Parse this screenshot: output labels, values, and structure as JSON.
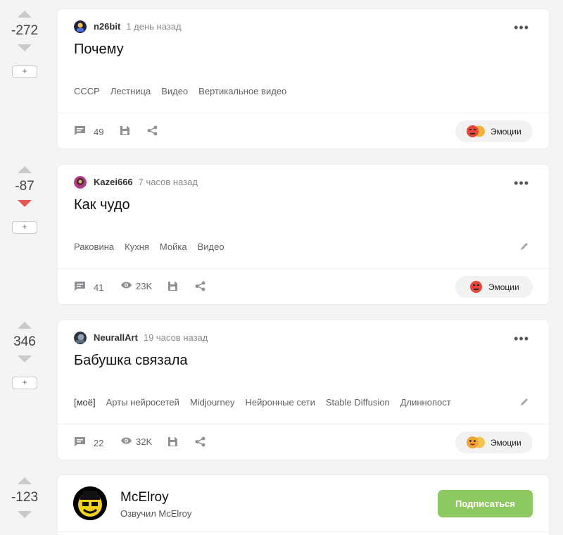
{
  "posts": [
    {
      "rating": "-272",
      "author": "n26bit",
      "time": "1 день назад",
      "title": "Почему",
      "tags": [
        "СССР",
        "Лестница",
        "Видео",
        "Вертикальное видео"
      ],
      "comments": "49",
      "views": "",
      "emotions_label": "Эмоции"
    },
    {
      "rating": "-87",
      "author": "Kazei666",
      "time": "7 часов назад",
      "title": "Как чудо",
      "tags": [
        "Раковина",
        "Кухня",
        "Мойка",
        "Видео"
      ],
      "comments": "41",
      "views": "23K",
      "emotions_label": "Эмоции"
    },
    {
      "rating": "346",
      "author": "NeurallArt",
      "time": "19 часов назад",
      "title": "Бабушка связала",
      "tags": [
        "[моё]",
        "Арты нейросетей",
        "Midjourney",
        "Нейронные сети",
        "Stable Diffusion",
        "Длиннопост"
      ],
      "comments": "22",
      "views": "32K",
      "emotions_label": "Эмоции"
    }
  ],
  "profile": {
    "rating": "-123",
    "name": "McElroy",
    "subtitle": "Озвучил McElroy",
    "subscribe_label": "Подписаться"
  },
  "rail": {
    "plus_label": "+"
  },
  "icons": {
    "upvote": "upvote-arrow-icon",
    "downvote": "downvote-arrow-icon",
    "comment": "comment-icon",
    "views": "eye-icon",
    "save": "save-icon",
    "share": "share-icon",
    "edit": "pencil-icon",
    "more": "more-dots-icon"
  },
  "colors": {
    "downvote_active": "#e8564b",
    "subscribe": "#8dc861",
    "background": "#f4f4f5"
  }
}
